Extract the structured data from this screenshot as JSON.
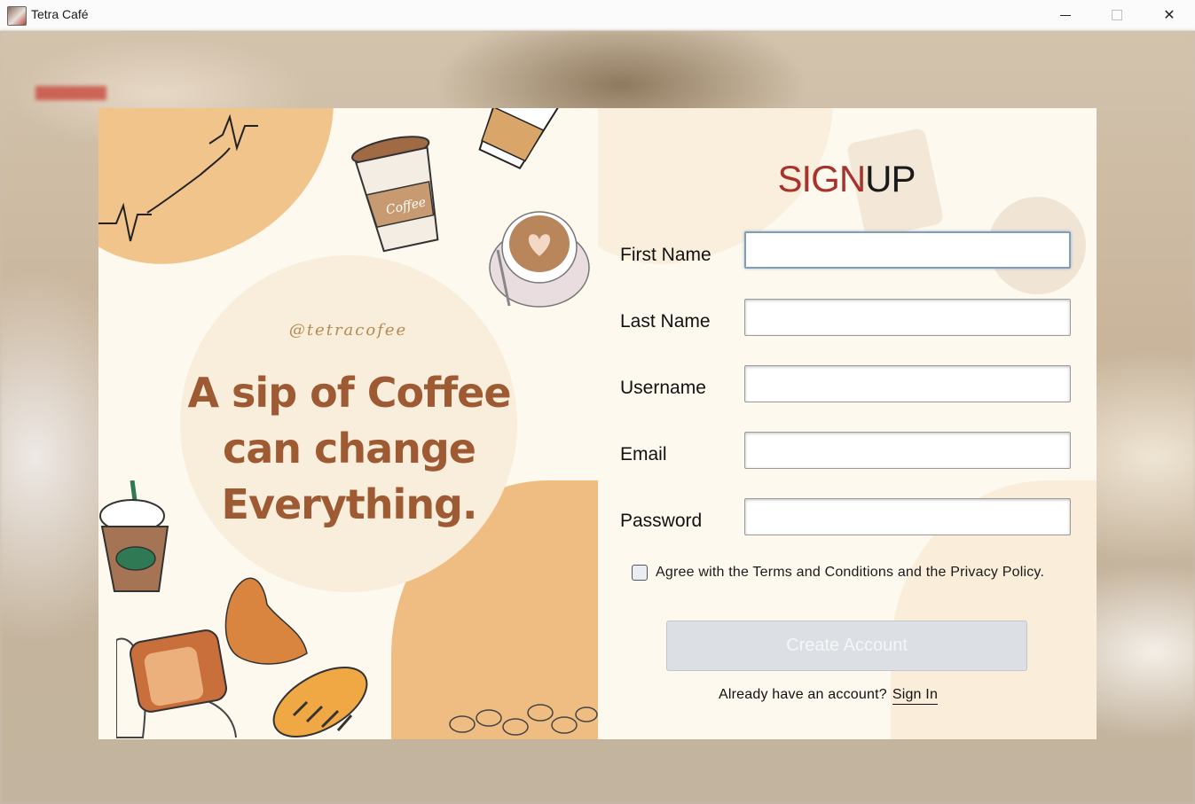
{
  "window": {
    "title": "Tetra Café",
    "minimize_label": "—",
    "close_label": "✕"
  },
  "left": {
    "handle": "@tetracofee",
    "tagline_line1": "A sip of Coffee",
    "tagline_line2": "can change",
    "tagline_line3": "Everything."
  },
  "form": {
    "title_part1": "SIGN",
    "title_part2": "UP",
    "fields": [
      {
        "label": "First Name",
        "value": ""
      },
      {
        "label": "Last Name",
        "value": ""
      },
      {
        "label": "Username",
        "value": ""
      },
      {
        "label": "Email",
        "value": ""
      },
      {
        "label": "Password",
        "value": ""
      }
    ],
    "terms_text": "Agree with the Terms and Conditions and the Privacy Policy.",
    "terms_checked": false,
    "submit_label": "Create Account",
    "already_text": "Already have an account?",
    "signin_label": "Sign In"
  },
  "colors": {
    "accent_red": "#a8332b",
    "tagline_brown": "#9e5a33",
    "blob_orange": "#efbd82"
  }
}
